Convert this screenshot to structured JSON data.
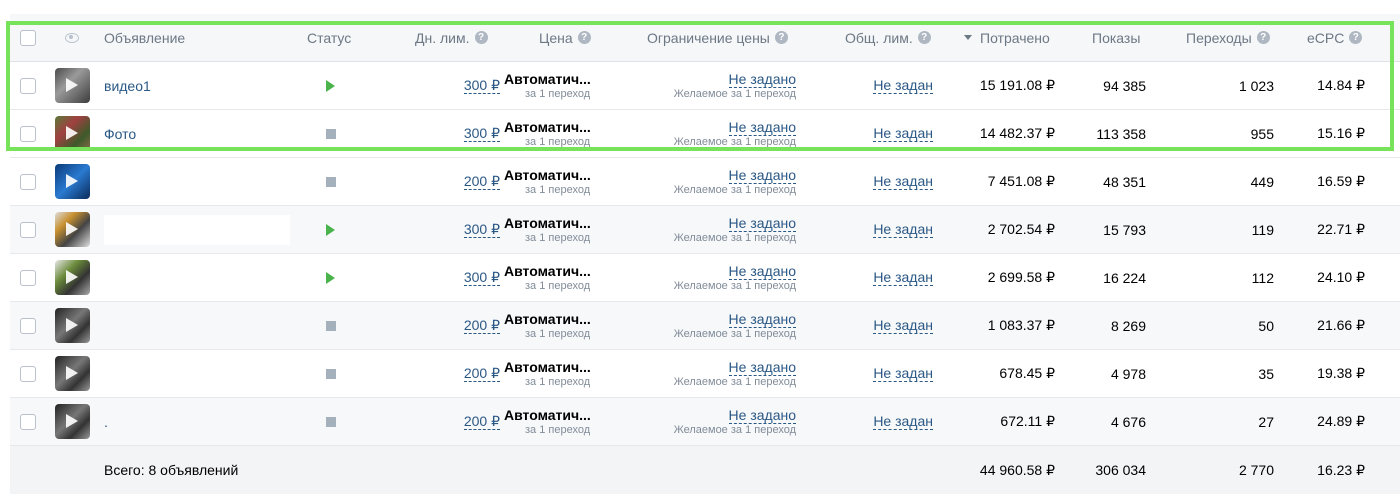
{
  "header": {
    "ad": "Объявление",
    "status": "Статус",
    "daily_limit": "Дн. лим.",
    "price": "Цена",
    "price_limit": "Ограничение цены",
    "total_limit": "Общ. лим.",
    "spent": "Потрачено",
    "impressions": "Показы",
    "clicks": "Переходы",
    "ecpc": "eCPC",
    "help_glyph": "?"
  },
  "rows": [
    {
      "name": "видео1",
      "status": "active",
      "daily": "300 ₽",
      "price": "Автоматич...",
      "price_sub": "за 1 переход",
      "limit": "Не задано",
      "limit_sub": "Желаемое за 1 переход",
      "total": "Не задан",
      "spent": "15 191.08 ₽",
      "impressions": "94 385",
      "clicks": "1 023",
      "ecpc": "14.84 ₽",
      "thumb": "video"
    },
    {
      "name": "Фото",
      "status": "stopped",
      "daily": "300 ₽",
      "price": "Автоматич...",
      "price_sub": "за 1 переход",
      "limit": "Не задано",
      "limit_sub": "Желаемое за 1 переход",
      "total": "Не задан",
      "spent": "14 482.37 ₽",
      "impressions": "113 358",
      "clicks": "955",
      "ecpc": "15.16 ₽",
      "thumb": "photo"
    },
    {
      "name": "",
      "status": "stopped",
      "daily": "200 ₽",
      "price": "Автоматич...",
      "price_sub": "за 1 переход",
      "limit": "Не задано",
      "limit_sub": "Желаемое за 1 переход",
      "total": "Не задан",
      "spent": "7 451.08 ₽",
      "impressions": "48 351",
      "clicks": "449",
      "ecpc": "16.59 ₽",
      "thumb": "blue"
    },
    {
      "name": "",
      "status": "active",
      "daily": "300 ₽",
      "price": "Автоматич...",
      "price_sub": "за 1 переход",
      "limit": "Не задано",
      "limit_sub": "Желаемое за 1 переход",
      "total": "Не задан",
      "spent": "2 702.54 ₽",
      "impressions": "15 793",
      "clicks": "119",
      "ecpc": "22.71 ₽",
      "thumb": "mix"
    },
    {
      "name": "",
      "status": "active",
      "daily": "300 ₽",
      "price": "Автоматич...",
      "price_sub": "за 1 переход",
      "limit": "Не задано",
      "limit_sub": "Желаемое за 1 переход",
      "total": "Не задан",
      "spent": "2 699.58 ₽",
      "impressions": "16 224",
      "clicks": "112",
      "ecpc": "24.10 ₽",
      "thumb": "green"
    },
    {
      "name": "",
      "status": "stopped",
      "daily": "200 ₽",
      "price": "Автоматич...",
      "price_sub": "за 1 переход",
      "limit": "Не задано",
      "limit_sub": "Желаемое за 1 переход",
      "total": "Не задан",
      "spent": "1 083.37 ₽",
      "impressions": "8 269",
      "clicks": "50",
      "ecpc": "21.66 ₽",
      "thumb": "dark"
    },
    {
      "name": "",
      "status": "stopped",
      "daily": "200 ₽",
      "price": "Автоматич...",
      "price_sub": "за 1 переход",
      "limit": "Не задано",
      "limit_sub": "Желаемое за 1 переход",
      "total": "Не задан",
      "spent": "678.45 ₽",
      "impressions": "4 978",
      "clicks": "35",
      "ecpc": "19.38 ₽",
      "thumb": "dark"
    },
    {
      "name": ".",
      "status": "stopped",
      "daily": "200 ₽",
      "price": "Автоматич...",
      "price_sub": "за 1 переход",
      "limit": "Не задано",
      "limit_sub": "Желаемое за 1 переход",
      "total": "Не задан",
      "spent": "672.11 ₽",
      "impressions": "4 676",
      "clicks": "27",
      "ecpc": "24.89 ₽",
      "thumb": "dark"
    }
  ],
  "totals": {
    "label": "Всего: 8 объявлений",
    "spent": "44 960.58 ₽",
    "impressions": "306 034",
    "clicks": "2 770",
    "ecpc": "16.23 ₽"
  },
  "colors": {
    "highlight": "#76e35a",
    "link": "#2a5885",
    "active_status": "#4bb34b",
    "stopped_status": "#a5b0bd"
  }
}
